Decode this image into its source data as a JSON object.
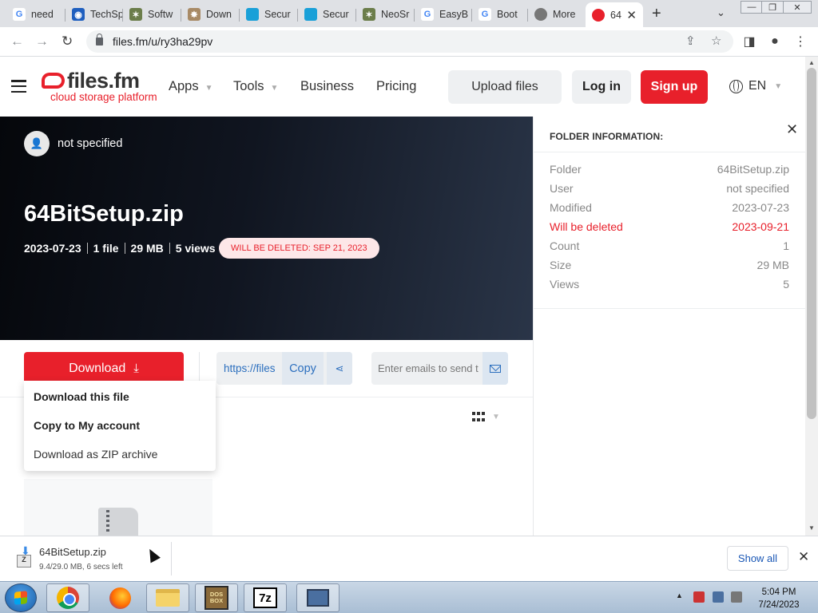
{
  "browser": {
    "tabs": [
      {
        "label": "need",
        "icon": "google-icon"
      },
      {
        "label": "TechSp",
        "icon": "techspot-icon"
      },
      {
        "label": "Softw",
        "icon": "softpedia-icon"
      },
      {
        "label": "Down",
        "icon": "download-site-icon"
      },
      {
        "label": "Secur",
        "icon": "secure-site-icon"
      },
      {
        "label": "Secur",
        "icon": "secure-site-icon"
      },
      {
        "label": "NeoSr",
        "icon": "neosmart-icon"
      },
      {
        "label": "EasyB",
        "icon": "google-icon"
      },
      {
        "label": "Boot",
        "icon": "google-icon"
      },
      {
        "label": "More",
        "icon": "globe-icon"
      },
      {
        "label": "64",
        "icon": "filesfm-icon",
        "active": true
      }
    ],
    "new_tab": "+",
    "url": "files.fm/u/ry3ha29pv"
  },
  "header": {
    "logo_main": "files.fm",
    "logo_sub": "cloud storage platform",
    "nav": [
      {
        "label": "Apps",
        "has_caret": true
      },
      {
        "label": "Tools",
        "has_caret": true
      },
      {
        "label": "Business",
        "has_caret": false
      },
      {
        "label": "Pricing",
        "has_caret": false
      }
    ],
    "upload_label": "Upload files",
    "login_label": "Log in",
    "signup_label": "Sign up",
    "language": "EN"
  },
  "hero": {
    "owner": "not specified",
    "title": "64BitSetup.zip",
    "date": "2023-07-23",
    "files": "1 file",
    "size": "29 MB",
    "views": "5 views",
    "delete_badge": "WILL BE DELETED: SEP 21, 2023"
  },
  "actions": {
    "download_label": "Download",
    "link_text": "https://files",
    "copy_label": "Copy",
    "email_placeholder": "Enter emails to send t"
  },
  "dropdown": {
    "items": [
      {
        "label": "Download this file",
        "bold": true
      },
      {
        "label": "Copy to My account",
        "bold": true
      },
      {
        "label": "Download as ZIP archive",
        "bold": false
      }
    ]
  },
  "folder_info": {
    "heading": "FOLDER INFORMATION:",
    "rows": [
      {
        "label": "Folder",
        "value": "64BitSetup.zip",
        "highlight": false
      },
      {
        "label": "User",
        "value": "not specified",
        "highlight": false
      },
      {
        "label": "Modified",
        "value": "2023-07-23",
        "highlight": false
      },
      {
        "label": "Will be deleted",
        "value": "2023-09-21",
        "highlight": true
      },
      {
        "label": "Count",
        "value": "1",
        "highlight": false
      },
      {
        "label": "Size",
        "value": "29 MB",
        "highlight": false
      },
      {
        "label": "Views",
        "value": "5",
        "highlight": false
      }
    ]
  },
  "download_shelf": {
    "filename": "64BitSetup.zip",
    "status": "9.4/29.0 MB, 6 secs left",
    "show_all": "Show all"
  },
  "taskbar": {
    "time": "5:04 PM",
    "date": "7/24/2023",
    "apps": [
      "chrome",
      "firefox",
      "file-explorer",
      "dosbox",
      "7-zip",
      "computer"
    ]
  },
  "colors": {
    "brand_red": "#e8202b",
    "link_blue": "#2c6fbe"
  }
}
